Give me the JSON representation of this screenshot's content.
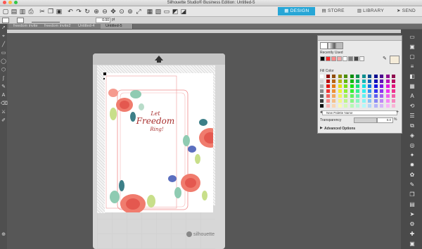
{
  "app": {
    "title": "Silhouette Studio® Business Edition: Untitled-5",
    "accent": "#27a6d6"
  },
  "nav": {
    "design": "DESIGN",
    "store": "STORE",
    "library": "LIBRARY",
    "send": "SEND"
  },
  "optbar": {
    "unit": "pt",
    "value": "0.00"
  },
  "tabs": [
    "freedom invite",
    "freedom invite2",
    "Untitled-4",
    "Untitled-5"
  ],
  "artwork": {
    "line1": "Let",
    "line2": "Freedom",
    "line3": "Ring!"
  },
  "mat": {
    "brand": "silhouette"
  },
  "panel": {
    "recently_used": "Recently Used",
    "fill_color": "Fill Color",
    "palette_name": "New Palette Name",
    "transparency": "Transparency",
    "transparency_value": "0.0",
    "transparency_unit": "%",
    "advanced": "Advanced Options",
    "recent_colors": [
      "#000000",
      "#ff2d2d",
      "#ff8a8a",
      "#f6a8a8",
      "#ffffff",
      "#7f7f7f",
      "#444444",
      "#f2f2f2"
    ],
    "grays": [
      "#ffffff",
      "#e0e0e0",
      "#c0c0c0",
      "#a0a0a0",
      "#808080",
      "#606060",
      "#404040",
      "#202020",
      "#000000",
      "#b0b0b0",
      "#d0d0d0",
      "#f0f0f0",
      "#ffffff"
    ]
  }
}
